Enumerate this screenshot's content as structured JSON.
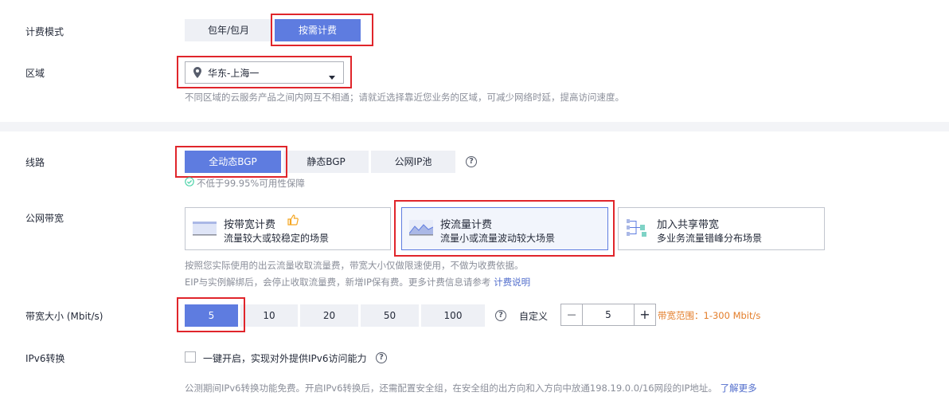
{
  "billing": {
    "label": "计费模式",
    "options": [
      "包年/包月",
      "按需计费"
    ],
    "selected": "按需计费"
  },
  "region": {
    "label": "区域",
    "value": "华东-上海一",
    "hint": "不同区域的云服务产品之间内网互不相通；请就近选择靠近您业务的区域，可减少网络时延，提高访问速度。"
  },
  "line": {
    "label": "线路",
    "options": [
      "全动态BGP",
      "静态BGP",
      "公网IP池"
    ],
    "selected": "全动态BGP",
    "availability": "不低于99.95%可用性保障"
  },
  "bandwidth_type": {
    "label": "公网带宽",
    "cards": [
      {
        "title": "按带宽计费",
        "subtitle": "流量较大或较稳定的场景"
      },
      {
        "title": "按流量计费",
        "subtitle": "流量小或流量波动较大场景"
      },
      {
        "title": "加入共享带宽",
        "subtitle": "多业务流量错峰分布场景"
      }
    ],
    "selected": "按流量计费",
    "hint1": "按照您实际使用的出云流量收取流量费，带宽大小仅做限速使用，不做为收费依据。",
    "hint2": "EIP与实例解绑后，会停止收取流量费，新增IP保有费。更多计费信息请参考",
    "hint2_link": "计费说明"
  },
  "bandwidth_size": {
    "label": "带宽大小 (Mbit/s)",
    "options": [
      "5",
      "10",
      "20",
      "50",
      "100"
    ],
    "selected": "5",
    "custom_label": "自定义",
    "stepper_value": "5",
    "minus": "—",
    "plus": "+",
    "range_text": "带宽范围：1-300 Mbit/s"
  },
  "ipv6": {
    "label": "IPv6转换",
    "checkbox_label": "一键开启，实现对外提供IPv6访问能力",
    "hint": "公测期间IPv6转换功能免费。开启IPv6转换后，还需配置安全组，在安全组的出方向和入方向中放通198.19.0.0/16网段的IP地址。",
    "hint_link": "了解更多"
  },
  "colors": {
    "accent": "#5e7ce0",
    "highlight": "#e0252b",
    "range": "#e37d29",
    "success": "#50d4ab"
  }
}
